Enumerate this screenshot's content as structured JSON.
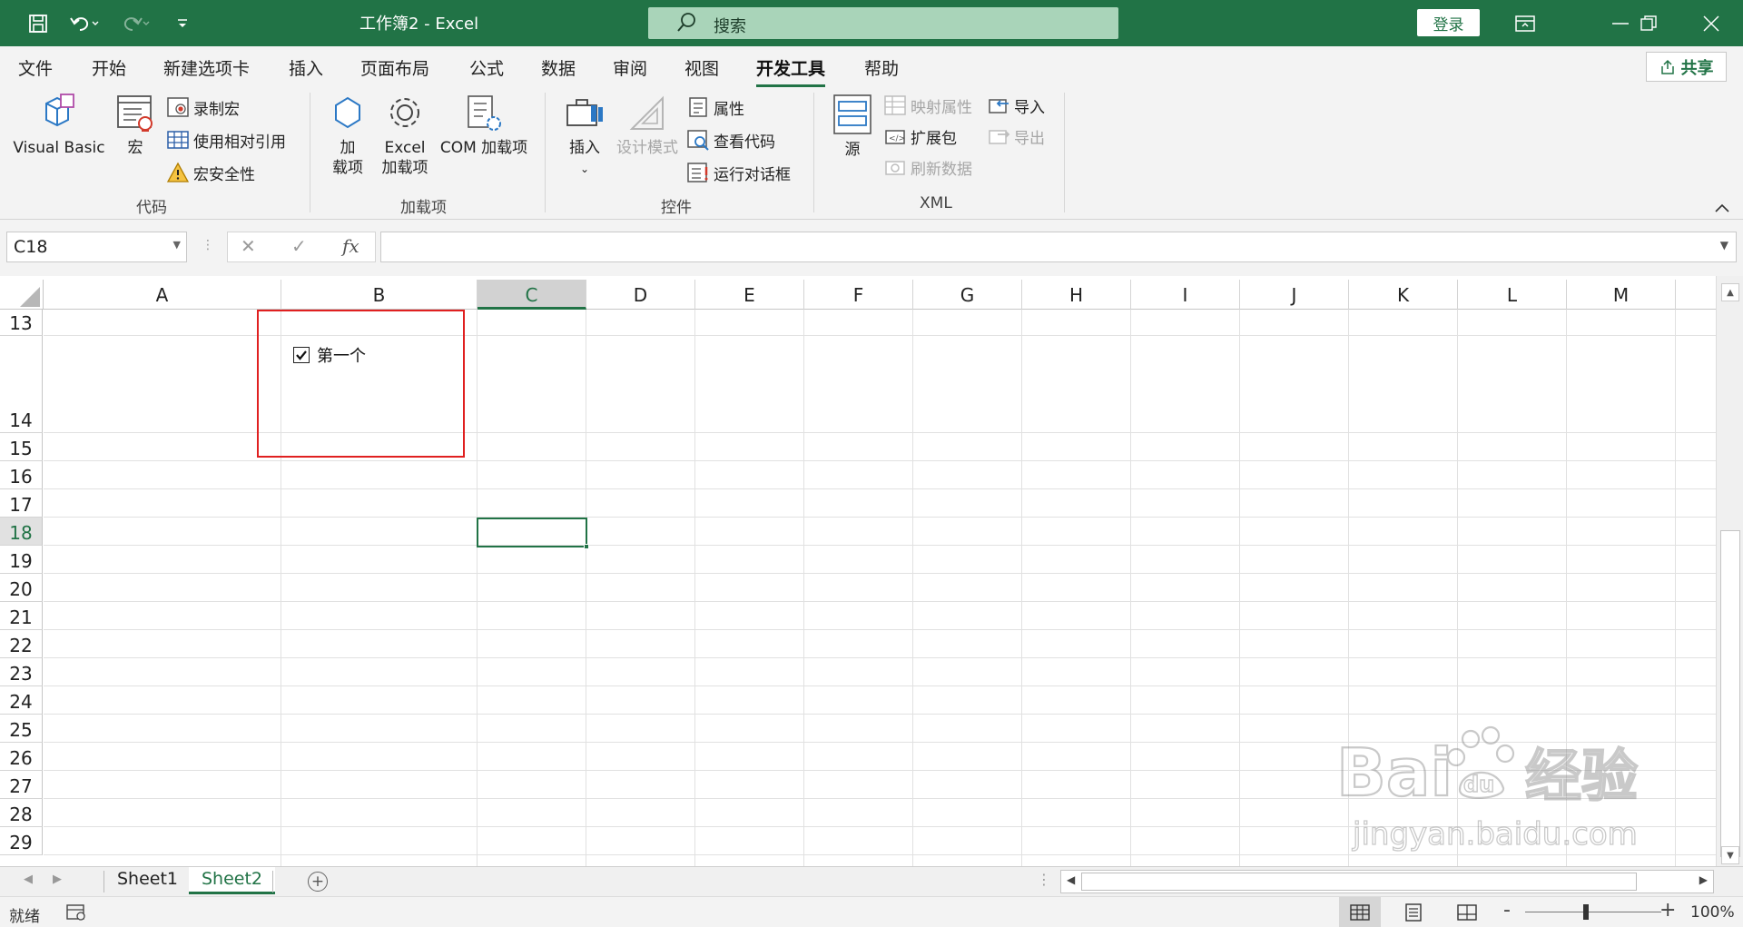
{
  "titlebar": {
    "title": "工作簿2  -  Excel",
    "search_placeholder": "搜索",
    "login_label": "登录"
  },
  "tabs": [
    "文件",
    "开始",
    "新建选项卡",
    "插入",
    "页面布局",
    "公式",
    "数据",
    "审阅",
    "视图",
    "开发工具",
    "帮助"
  ],
  "active_tab": "开发工具",
  "share_label": "共享",
  "ribbon": {
    "code": {
      "label": "代码",
      "visual_basic": "Visual Basic",
      "macros": "宏",
      "record_macro": "录制宏",
      "relative_ref": "使用相对引用",
      "macro_security": "宏安全性"
    },
    "addins": {
      "label": "加载项",
      "addins_line1": "加",
      "addins_line2": "载项",
      "excel_addins_line1": "Excel",
      "excel_addins_line2": "加载项",
      "com_addins": "COM 加载项"
    },
    "controls": {
      "label": "控件",
      "insert": "插入",
      "design_mode": "设计模式",
      "properties": "属性",
      "view_code": "查看代码",
      "run_dialog": "运行对话框"
    },
    "xml": {
      "label": "XML",
      "source": "源",
      "map_properties": "映射属性",
      "expansion_packs": "扩展包",
      "refresh_data": "刷新数据",
      "import": "导入",
      "export": "导出"
    }
  },
  "formula_bar": {
    "name_box": "C18",
    "cancel": "✕",
    "enter": "✓",
    "fx": "fx",
    "formula": ""
  },
  "grid": {
    "columns": [
      "A",
      "B",
      "C",
      "D",
      "E",
      "F",
      "G",
      "H",
      "I",
      "J",
      "K",
      "L",
      "M"
    ],
    "selected_column": "C",
    "rows": [
      "13",
      "14",
      "15",
      "16",
      "17",
      "18",
      "19",
      "20",
      "21",
      "22",
      "23",
      "24",
      "25",
      "26",
      "27",
      "28",
      "29"
    ],
    "selected_row": "18",
    "active_cell": "C18"
  },
  "checkbox": {
    "label": "第一个",
    "checked": true
  },
  "sheets": [
    "Sheet1",
    "Sheet2"
  ],
  "active_sheet": "Sheet2",
  "status": {
    "ready": "就绪",
    "zoom": "100%",
    "zoom_minus": "-",
    "zoom_plus": "+"
  },
  "watermark": {
    "text1": "Bai",
    "text2": "du",
    "text3": "经验",
    "url": "jingyan.baidu.com"
  },
  "colors": {
    "excel_green": "#217346",
    "highlight_red": "#e02020"
  }
}
